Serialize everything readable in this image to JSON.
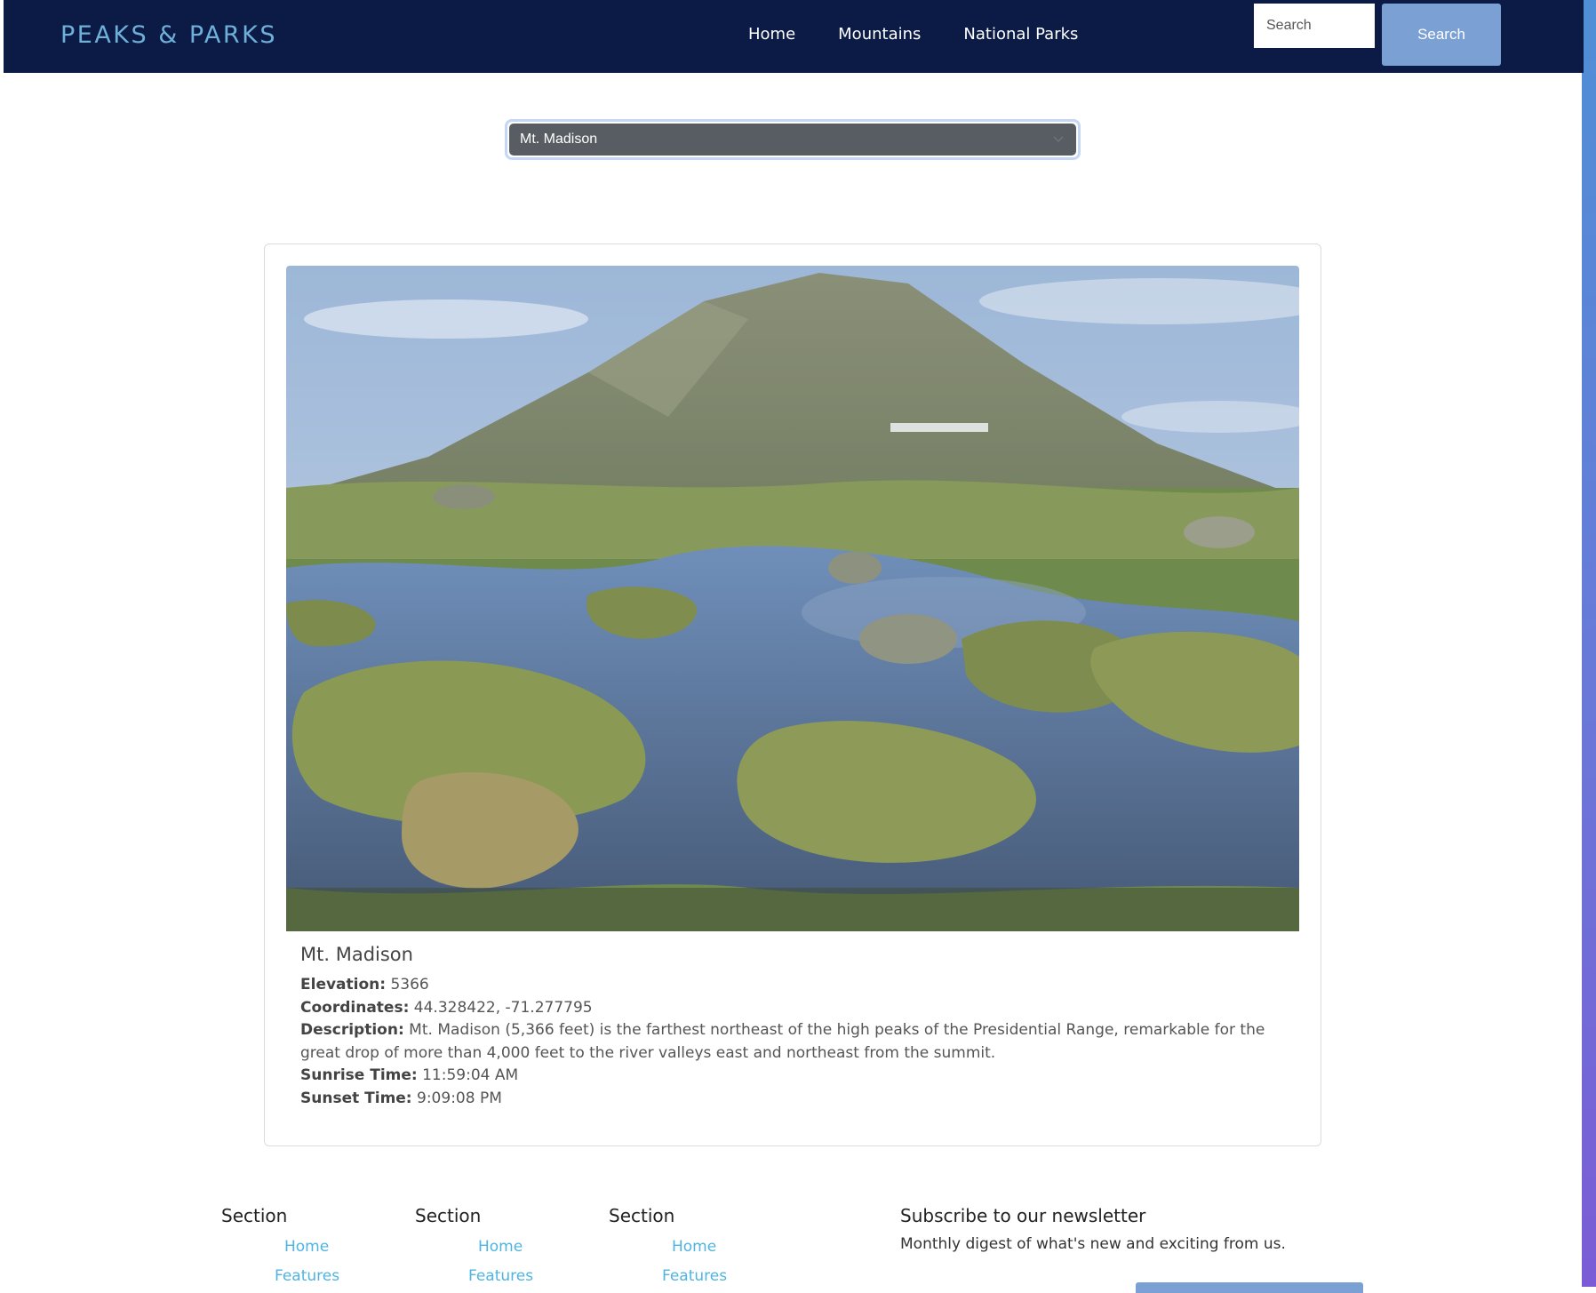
{
  "brand": "PEAKS & PARKS",
  "nav": {
    "links": [
      "Home",
      "Mountains",
      "National Parks"
    ],
    "search_placeholder": "Search",
    "search_button": "Search"
  },
  "mountain_select": {
    "selected": "Mt. Madison"
  },
  "mountain": {
    "name": "Mt. Madison",
    "image_alt": "Mountain peak with alpine pond and grass tussocks",
    "elevation_label": "Elevation:",
    "elevation": "5366",
    "coordinates_label": "Coordinates:",
    "coordinates": "44.328422, -71.277795",
    "description_label": "Description:",
    "description": "Mt. Madison (5,366 feet) is the farthest northeast of the high peaks of the Presidential Range, remarkable for the great drop of more than 4,000 feet to the river valleys east and northeast from the summit.",
    "sunrise_label": "Sunrise Time:",
    "sunrise": "11:59:04 AM",
    "sunset_label": "Sunset Time:",
    "sunset": "9:09:08 PM"
  },
  "footer": {
    "sections": [
      {
        "heading": "Section",
        "links": [
          "Home",
          "Features"
        ]
      },
      {
        "heading": "Section",
        "links": [
          "Home",
          "Features"
        ]
      },
      {
        "heading": "Section",
        "links": [
          "Home",
          "Features"
        ]
      }
    ],
    "newsletter": {
      "heading": "Subscribe to our newsletter",
      "subtitle": "Monthly digest of what's new and exciting from us."
    }
  },
  "colors": {
    "navbar": "#0b1b45",
    "brand": "#6fb0d8",
    "button": "#7aa0d4",
    "footer_link": "#4fb4e0"
  }
}
